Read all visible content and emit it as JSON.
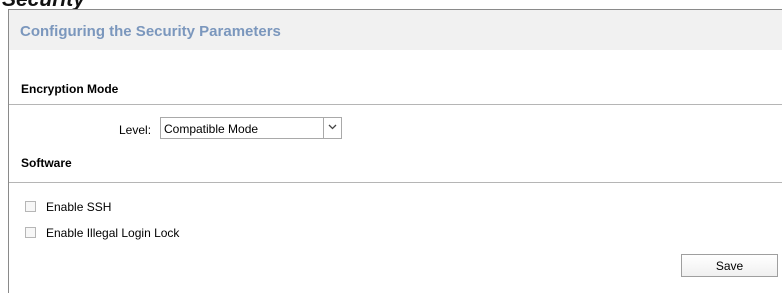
{
  "header_fragment": "Security",
  "panel": {
    "title": "Configuring the Security Parameters"
  },
  "encryption": {
    "section_title": "Encryption Mode",
    "level_label": "Level:",
    "level_value": "Compatible Mode"
  },
  "software": {
    "section_title": "Software",
    "options": [
      {
        "label": "Enable SSH",
        "checked": false
      },
      {
        "label": "Enable Illegal Login Lock",
        "checked": false
      }
    ]
  },
  "actions": {
    "save_label": "Save"
  },
  "colors": {
    "title_blue": "#7b97bd",
    "header_bg": "#f1f1f1"
  }
}
